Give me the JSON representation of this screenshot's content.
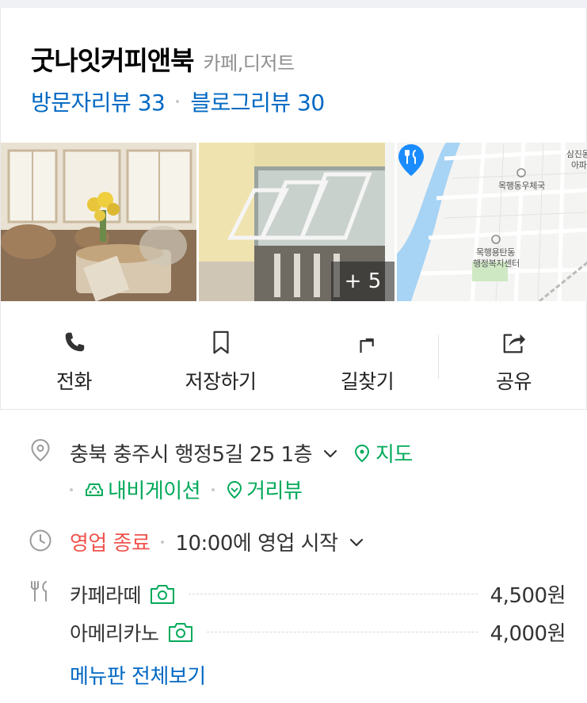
{
  "place": {
    "name": "굿나잇커피앤북",
    "category": "카페,디저트"
  },
  "reviews": {
    "visitor_label": "방문자리뷰 33",
    "blog_label": "블로그리뷰 30"
  },
  "photos": {
    "more_count": "+ 5"
  },
  "map": {
    "labels": [
      "삼진동",
      "아파",
      "목행동우체국",
      "목행용탄동",
      "행정복지센터"
    ]
  },
  "actions": [
    {
      "label": "전화",
      "icon": "phone-icon"
    },
    {
      "label": "저장하기",
      "icon": "bookmark-icon"
    },
    {
      "label": "길찾기",
      "icon": "directions-icon"
    },
    {
      "label": "공유",
      "icon": "share-icon"
    }
  ],
  "address": {
    "text": "충북 충주시 행정5길 25 1층",
    "map_link": "지도",
    "navigation_link": "내비게이션",
    "streetview_link": "거리뷰"
  },
  "hours": {
    "status": "영업 종료",
    "next_open": "10:00에 영업 시작"
  },
  "menu": {
    "items": [
      {
        "name": "카페라떼",
        "price": "4,500원"
      },
      {
        "name": "아메리카노",
        "price": "4,000원"
      }
    ],
    "view_all": "메뉴판 전체보기"
  },
  "colors": {
    "link_blue": "#0068c3",
    "green": "#03aa5a",
    "closed_red": "#f0544e",
    "map_pin": "#1a8cff"
  }
}
